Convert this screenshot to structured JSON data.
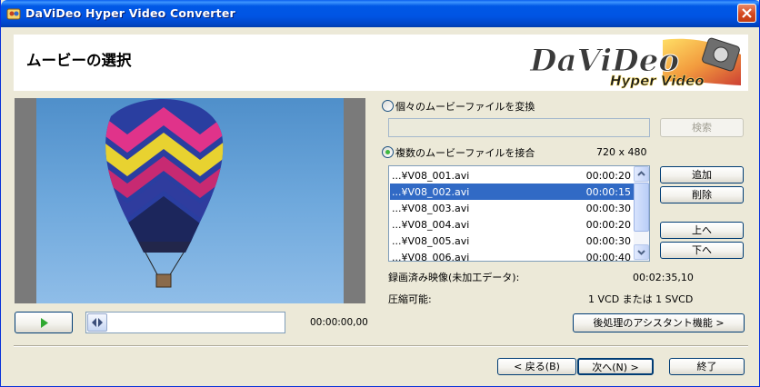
{
  "window": {
    "title": "DaViDeo Hyper Video Converter"
  },
  "header": {
    "page_title": "ムービーの選択",
    "logo_text": "DaViDeo",
    "logo_subtext": "Hyper Video"
  },
  "source": {
    "single_option_label": "個々のムービーファイルを変換",
    "single_path_value": "",
    "browse_label": "検索",
    "multi_option_label": "複数のムービーファイルを接合",
    "selected_option": "multi",
    "resolution": "720 x 480"
  },
  "files": [
    {
      "name": "...¥V08_001.avi",
      "duration": "00:00:20"
    },
    {
      "name": "...¥V08_002.avi",
      "duration": "00:00:15"
    },
    {
      "name": "...¥V08_003.avi",
      "duration": "00:00:30"
    },
    {
      "name": "...¥V08_004.avi",
      "duration": "00:00:20"
    },
    {
      "name": "...¥V08_005.avi",
      "duration": "00:00:30"
    },
    {
      "name": "...¥V08_006.avi",
      "duration": "00:00:40"
    }
  ],
  "selected_file_index": 1,
  "list_buttons": {
    "add": "追加",
    "remove": "削除",
    "up": "上へ",
    "down": "下へ"
  },
  "info": {
    "recorded_label": "録画済み映像(未加工データ):",
    "recorded_value": "00:02:35,10",
    "compress_label": "圧縮可能:",
    "compress_value": "1 VCD または 1 SVCD"
  },
  "player": {
    "timecode": "00:00:00,00"
  },
  "post_assistant_label": "後処理のアシスタント機能 >",
  "nav": {
    "back": "< 戻る(B)",
    "next": "次へ(N) >",
    "finish": "終了"
  },
  "colors": {
    "titlebar": "#0054e3",
    "selection": "#316ac5",
    "sky": "#6ea8dc"
  }
}
